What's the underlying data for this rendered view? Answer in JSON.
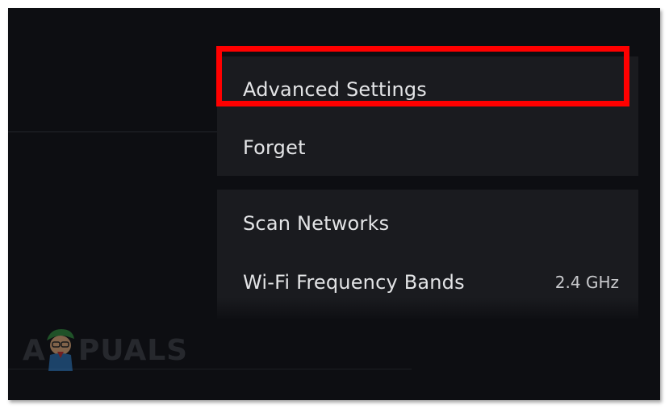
{
  "menu": {
    "group1": [
      {
        "label": "Advanced Settings"
      },
      {
        "label": "Forget"
      }
    ],
    "group2": [
      {
        "label": "Scan Networks"
      },
      {
        "label": "Wi-Fi Frequency Bands",
        "value": "2.4 GHz"
      }
    ]
  },
  "watermark": {
    "text_left": "A",
    "text_right": "PUALS"
  },
  "colors": {
    "highlight": "#ff0000",
    "panel": "#1a1b1f",
    "background": "#0d0e12",
    "text": "#e3e4e6"
  }
}
